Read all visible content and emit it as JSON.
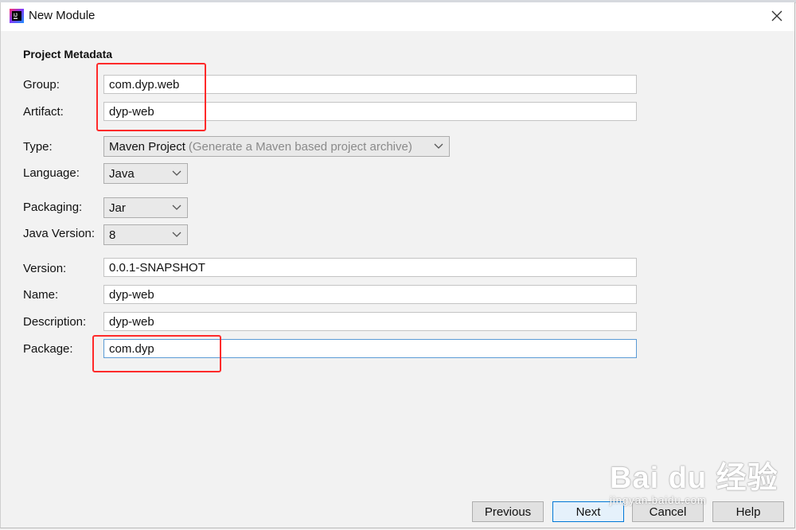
{
  "window": {
    "title": "New Module",
    "icon": "intellij-app-icon"
  },
  "section": {
    "header": "Project Metadata"
  },
  "fields": {
    "group": {
      "label": "Group:",
      "value": "com.dyp.web"
    },
    "artifact": {
      "label": "Artifact:",
      "value": "dyp-web"
    },
    "type": {
      "label": "Type:",
      "value": "Maven Project",
      "hint": "(Generate a Maven based project archive)"
    },
    "language": {
      "label": "Language:",
      "value": "Java"
    },
    "packaging": {
      "label": "Packaging:",
      "value": "Jar"
    },
    "java_version": {
      "label": "Java Version:",
      "value": "8"
    },
    "version": {
      "label": "Version:",
      "value": "0.0.1-SNAPSHOT"
    },
    "name": {
      "label": "Name:",
      "value": "dyp-web"
    },
    "description": {
      "label": "Description:",
      "value": "dyp-web"
    },
    "package": {
      "label": "Package:",
      "value": "com.dyp"
    }
  },
  "buttons": {
    "previous": "Previous",
    "next": "Next",
    "cancel": "Cancel",
    "help": "Help"
  },
  "watermark": {
    "main": "Bai du 经验",
    "sub": "jingyan.baidu.com"
  },
  "colors": {
    "highlight": "#ff2a2a",
    "focus": "#5b9bd5",
    "accent": "#0078d7"
  }
}
